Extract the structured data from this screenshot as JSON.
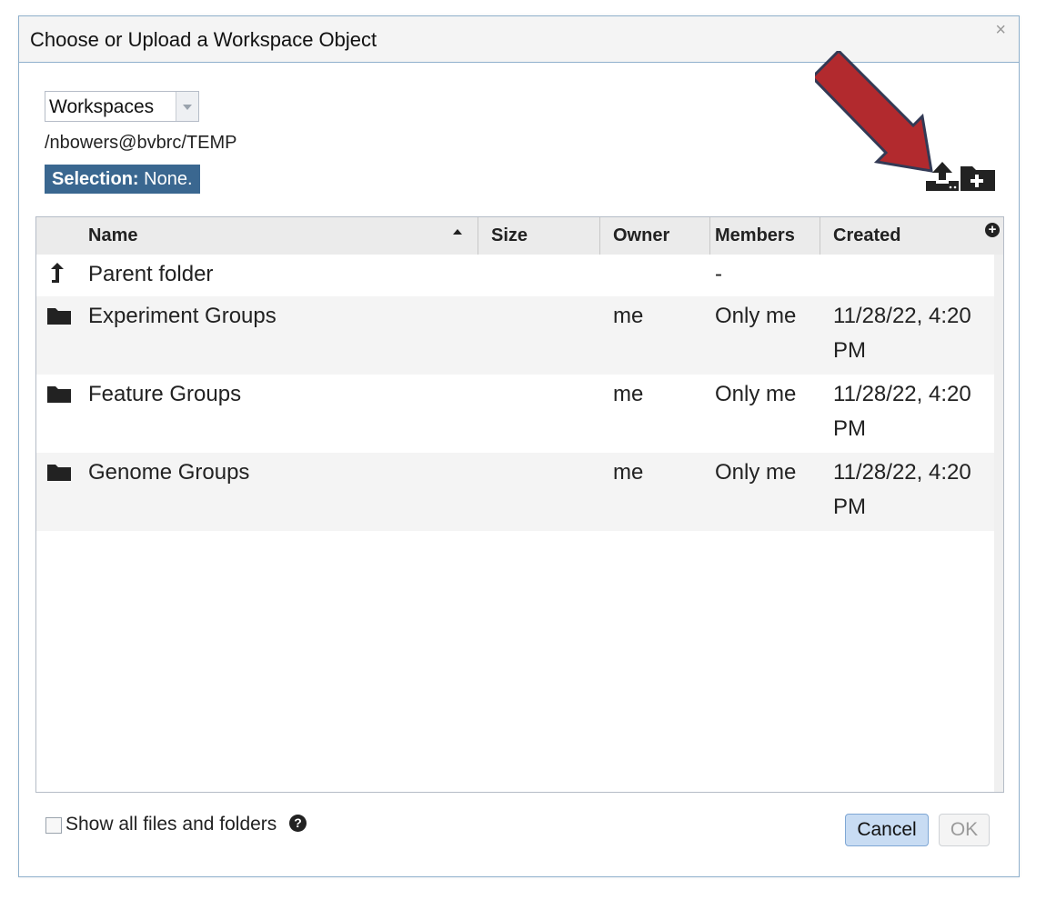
{
  "dialog": {
    "title": "Choose or Upload a Workspace Object",
    "close_glyph": "×"
  },
  "workspace_select": {
    "value": "Workspaces"
  },
  "path": "/nbowers@bvbrc/TEMP",
  "selection": {
    "label": "Selection:",
    "value": "None."
  },
  "toolbar": {
    "upload_icon": "upload-icon",
    "new_folder_icon": "new-folder-icon"
  },
  "annotation": {
    "arrow_color": "#b22a2e"
  },
  "grid": {
    "columns": [
      "Name",
      "Size",
      "Owner",
      "Members",
      "Created"
    ],
    "sort_column": "Name",
    "sort_direction": "ascending",
    "add_column_glyph": "+",
    "rows": [
      {
        "icon": "up-arrow-icon",
        "name": "Parent folder",
        "size": "",
        "owner": "",
        "members": "-",
        "created_line1": "",
        "created_line2": ""
      },
      {
        "icon": "folder-icon",
        "name": "Experiment Groups",
        "size": "",
        "owner": "me",
        "members": "Only me",
        "created_line1": "11/28/22, 4:20",
        "created_line2": "PM"
      },
      {
        "icon": "folder-icon",
        "name": "Feature Groups",
        "size": "",
        "owner": "me",
        "members": "Only me",
        "created_line1": "11/28/22, 4:20",
        "created_line2": "PM"
      },
      {
        "icon": "folder-icon",
        "name": "Genome Groups",
        "size": "",
        "owner": "me",
        "members": "Only me",
        "created_line1": "11/28/22, 4:20",
        "created_line2": "PM"
      }
    ]
  },
  "footer": {
    "show_all_label": "Show all files and folders",
    "show_all_checked": false,
    "help_glyph": "?",
    "cancel_label": "Cancel",
    "ok_label": "OK"
  },
  "colors": {
    "selection_bg": "#3a6790",
    "cancel_bg": "#c8dcf3",
    "border_blue": "#8fb0cc"
  }
}
